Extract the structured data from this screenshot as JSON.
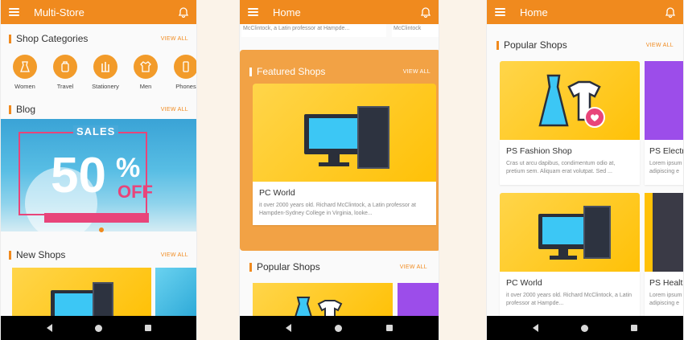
{
  "screens": [
    {
      "title": "Multi-Store",
      "categories_title": "Shop Categories",
      "view_all": "VIEW ALL",
      "categories": [
        "Women",
        "Travel",
        "Stationery",
        "Men",
        "Phones"
      ],
      "blog_title": "Blog",
      "banner": {
        "sales": "SALES",
        "number": "50",
        "percent": "%",
        "off": "OFF"
      },
      "new_shops_title": "New Shops"
    },
    {
      "title": "Home",
      "top_snippet": "McClintock, a Latin professor at Hampde...",
      "top_snippet_right": "McClintock",
      "featured_title": "Featured Shops",
      "view_all": "VIEW ALL",
      "featured_shop": {
        "name": "PC World",
        "desc": "it over 2000 years old. Richard McClintock, a Latin professor at Hampden-Sydney College in Virginia, looke..."
      },
      "popular_title": "Popular Shops"
    },
    {
      "title": "Home",
      "popular_title": "Popular Shops",
      "view_all": "VIEW ALL",
      "shops": [
        {
          "name": "PS Fashion Shop",
          "desc": "Cras ut arcu dapibus, condimentum odio at, pretium sem. Aliquam erat volutpat. Sed ..."
        },
        {
          "name": "PS Electr",
          "desc": "Lorem ipsum adipiscing e"
        },
        {
          "name": "PC World",
          "desc": "it over 2000 years old. Richard McClintock, a Latin professor at Hampde..."
        },
        {
          "name": "PS Health",
          "desc": "Lorem ipsum adipiscing e"
        }
      ]
    }
  ],
  "colors": {
    "primary": "#f08a1e",
    "featured_bg": "#f2a245",
    "thumb_yellow": "#ffc107",
    "screen_blue": "#3cc7f5",
    "accent_pink": "#e8457a",
    "purple": "#9c4dea"
  }
}
